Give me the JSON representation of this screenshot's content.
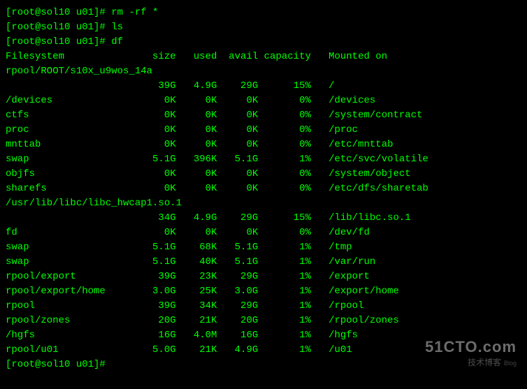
{
  "prompt_user": "root",
  "prompt_host": "sol10",
  "prompt_dir": "u01",
  "commands": [
    {
      "cmd": "rm -rf *"
    },
    {
      "cmd": "ls"
    },
    {
      "cmd": "df"
    }
  ],
  "df_header": {
    "filesystem": "Filesystem",
    "size": "size",
    "used": "used",
    "avail": "avail",
    "capacity": "capacity",
    "mounted": "Mounted on"
  },
  "df_rows": [
    {
      "fs": "rpool/ROOT/s10x_u9wos_14a",
      "wrap": true,
      "size": "39G",
      "used": "4.9G",
      "avail": "29G",
      "cap": "15%",
      "mnt": "/"
    },
    {
      "fs": "/devices",
      "size": "0K",
      "used": "0K",
      "avail": "0K",
      "cap": "0%",
      "mnt": "/devices"
    },
    {
      "fs": "ctfs",
      "size": "0K",
      "used": "0K",
      "avail": "0K",
      "cap": "0%",
      "mnt": "/system/contract"
    },
    {
      "fs": "proc",
      "size": "0K",
      "used": "0K",
      "avail": "0K",
      "cap": "0%",
      "mnt": "/proc"
    },
    {
      "fs": "mnttab",
      "size": "0K",
      "used": "0K",
      "avail": "0K",
      "cap": "0%",
      "mnt": "/etc/mnttab"
    },
    {
      "fs": "swap",
      "size": "5.1G",
      "used": "396K",
      "avail": "5.1G",
      "cap": "1%",
      "mnt": "/etc/svc/volatile"
    },
    {
      "fs": "objfs",
      "size": "0K",
      "used": "0K",
      "avail": "0K",
      "cap": "0%",
      "mnt": "/system/object"
    },
    {
      "fs": "sharefs",
      "size": "0K",
      "used": "0K",
      "avail": "0K",
      "cap": "0%",
      "mnt": "/etc/dfs/sharetab"
    },
    {
      "fs": "/usr/lib/libc/libc_hwcap1.so.1",
      "wrap": true,
      "size": "34G",
      "used": "4.9G",
      "avail": "29G",
      "cap": "15%",
      "mnt": "/lib/libc.so.1"
    },
    {
      "fs": "fd",
      "size": "0K",
      "used": "0K",
      "avail": "0K",
      "cap": "0%",
      "mnt": "/dev/fd"
    },
    {
      "fs": "swap",
      "size": "5.1G",
      "used": "68K",
      "avail": "5.1G",
      "cap": "1%",
      "mnt": "/tmp"
    },
    {
      "fs": "swap",
      "size": "5.1G",
      "used": "40K",
      "avail": "5.1G",
      "cap": "1%",
      "mnt": "/var/run"
    },
    {
      "fs": "rpool/export",
      "size": "39G",
      "used": "23K",
      "avail": "29G",
      "cap": "1%",
      "mnt": "/export"
    },
    {
      "fs": "rpool/export/home",
      "size": "3.0G",
      "used": "25K",
      "avail": "3.0G",
      "cap": "1%",
      "mnt": "/export/home"
    },
    {
      "fs": "rpool",
      "size": "39G",
      "used": "34K",
      "avail": "29G",
      "cap": "1%",
      "mnt": "/rpool"
    },
    {
      "fs": "rpool/zones",
      "size": "20G",
      "used": "21K",
      "avail": "20G",
      "cap": "1%",
      "mnt": "/rpool/zones"
    },
    {
      "fs": "/hgfs",
      "size": "16G",
      "used": "4.0M",
      "avail": "16G",
      "cap": "1%",
      "mnt": "/hgfs"
    },
    {
      "fs": "rpool/u01",
      "size": "5.0G",
      "used": "21K",
      "avail": "4.9G",
      "cap": "1%",
      "mnt": "/u01"
    }
  ],
  "watermark": {
    "domain": "51CTO.com",
    "sub": "技术博客",
    "tag": "Blog"
  }
}
